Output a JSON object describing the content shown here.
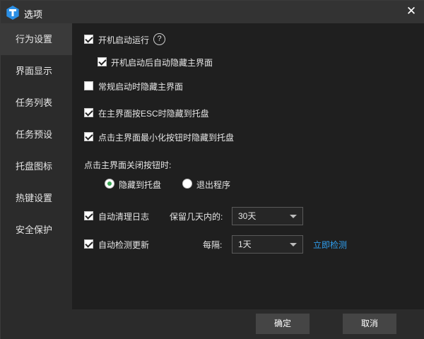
{
  "window": {
    "title": "选项"
  },
  "sidebar": {
    "items": [
      {
        "label": "行为设置",
        "active": true
      },
      {
        "label": "界面显示",
        "active": false
      },
      {
        "label": "任务列表",
        "active": false
      },
      {
        "label": "任务预设",
        "active": false
      },
      {
        "label": "托盘图标",
        "active": false
      },
      {
        "label": "热键设置",
        "active": false
      },
      {
        "label": "安全保护",
        "active": false
      }
    ]
  },
  "options": {
    "autostart": {
      "label": "开机启动运行",
      "checked": true,
      "help": "?"
    },
    "autostart_hide": {
      "label": "开机启动后自动隐藏主界面",
      "checked": true
    },
    "normal_hide": {
      "label": "常规启动时隐藏主界面",
      "checked": false
    },
    "esc_tray": {
      "label": "在主界面按ESC时隐藏到托盘",
      "checked": true
    },
    "minimize_tray": {
      "label": "点击主界面最小化按钮时隐藏到托盘",
      "checked": true
    }
  },
  "close_behavior": {
    "label": "点击主界面关闭按钮时:",
    "options": [
      {
        "label": "隐藏到托盘",
        "selected": true
      },
      {
        "label": "退出程序",
        "selected": false
      }
    ]
  },
  "log_cleanup": {
    "label": "自动清理日志",
    "checked": true,
    "keep_label": "保留几天内的:",
    "keep_value": "30天"
  },
  "update_check": {
    "label": "自动检测更新",
    "checked": true,
    "interval_label": "每隔:",
    "interval_value": "1天",
    "check_now": "立即检测"
  },
  "footer": {
    "ok": "确定",
    "cancel": "取消"
  },
  "colors": {
    "accent": "#3aa655",
    "link": "#2f9ff0",
    "logo": "#2b8fe5"
  }
}
